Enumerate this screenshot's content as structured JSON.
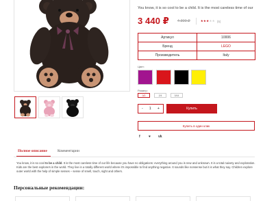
{
  "product": {
    "short_description": "You know, it is so cool to be a child. It is the most careless time of our",
    "price": "3 440 ₽",
    "old_price": "4 300 ₽",
    "rating_count": "(5)",
    "rating": 3,
    "rating_max": 5,
    "main_image_icon": "teddy-bear-brown"
  },
  "thumbnails": [
    {
      "icon": "teddy-bear-brown"
    },
    {
      "icon": "teddy-bear-pink"
    },
    {
      "icon": "teddy-bear-black"
    }
  ],
  "specs": [
    {
      "key": "Артикул",
      "value": "10006"
    },
    {
      "key": "Бренд",
      "value": "LEGO"
    },
    {
      "key": "Производитель",
      "value": "Italy"
    }
  ],
  "color_label": "Цвет:",
  "colors": [
    "#a2148f",
    "#d9151b",
    "#000000",
    "#ffef06"
  ],
  "size_label": "Размер:",
  "sizes": [
    "0/2",
    "2/4",
    "0/44"
  ],
  "quantity": {
    "minus": "-",
    "value": "1",
    "plus": "+"
  },
  "buy_label": "Купить",
  "one_click_label": "Купить в один клик",
  "share_icons": [
    "f",
    "♥",
    "vk"
  ],
  "tabs": {
    "full_description": "Полное описание",
    "comments": "Комментарии"
  },
  "description": {
    "part1": "You know, it is so cool ",
    "bold": "to be a child",
    "part2": ". It is the most careless time of our life because you have no obligations: everything around you is new and unknown. It is a total naivety and exploration. Kids are the best explorers in the world. They live in a totally different world where it's impossible to find anything negative. It sounds like nonsense but it is what they say. Children explore outer world with the help of simple senses – sense of smell, touch, sight and others."
  },
  "recommendations_title": "Персональные рекомендации:",
  "accent_color": "#c4161c"
}
